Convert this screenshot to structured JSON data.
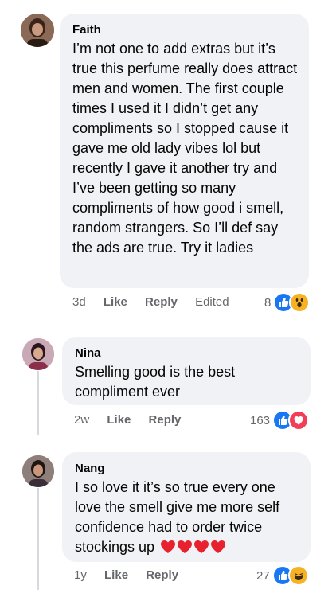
{
  "comments": [
    {
      "author": "Faith",
      "text": "I’m not one to add extras but it’s true this perfume really does attract men and women. The first couple times I used it I didn’t get any compliments so I stopped cause it gave me old lady vibes lol but recently I gave it another try and I’ve been getting so many compliments of how good i smell, random strangers. So I’ll def say the ads are true. Try it ladies",
      "time": "3d",
      "like": "Like",
      "reply": "Reply",
      "edited": "Edited",
      "reaction_count": "8",
      "reactions": [
        "like-icon",
        "wow-icon"
      ]
    },
    {
      "author": "Nina",
      "text": "Smelling good is the best compliment ever",
      "time": "2w",
      "like": "Like",
      "reply": "Reply",
      "reaction_count": "163",
      "reactions": [
        "like-icon",
        "love-icon"
      ]
    },
    {
      "author": "Nang",
      "text": "I so love it it’s so true every one love the smell give me more self confidence had to order twice stockings up",
      "emoji": "❤❤❤❤",
      "time": "1y",
      "like": "Like",
      "reply": "Reply",
      "reaction_count": "27",
      "reactions": [
        "like-icon",
        "haha-icon"
      ]
    }
  ],
  "colors": {
    "bubble": "#f0f2f5",
    "meta": "#65676b",
    "like_blue": "#1877f2",
    "love_red": "#f33e58",
    "emoji_yellow": "#f7b125"
  }
}
